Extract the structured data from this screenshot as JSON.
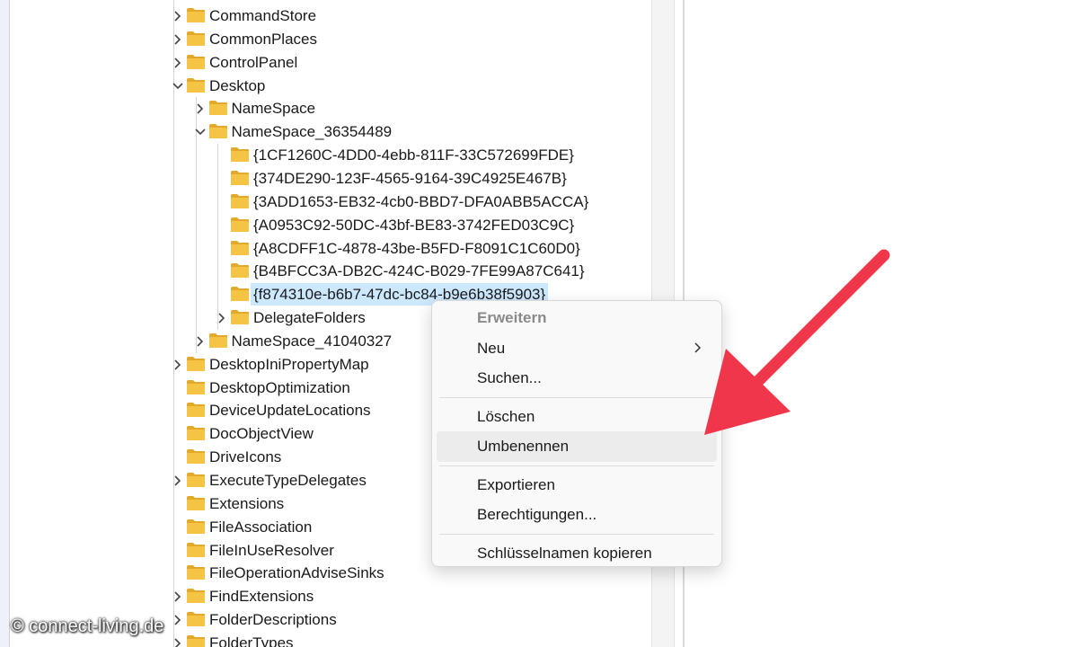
{
  "tree": {
    "nodes": [
      {
        "label": "CommandStore",
        "level": 0,
        "expander": "collapsed"
      },
      {
        "label": "CommonPlaces",
        "level": 0,
        "expander": "collapsed"
      },
      {
        "label": "ControlPanel",
        "level": 0,
        "expander": "collapsed"
      },
      {
        "label": "Desktop",
        "level": 0,
        "expander": "expanded"
      },
      {
        "label": "NameSpace",
        "level": 1,
        "expander": "collapsed"
      },
      {
        "label": "NameSpace_36354489",
        "level": 1,
        "expander": "expanded"
      },
      {
        "label": "{1CF1260C-4DD0-4ebb-811F-33C572699FDE}",
        "level": 2,
        "expander": "none"
      },
      {
        "label": "{374DE290-123F-4565-9164-39C4925E467B}",
        "level": 2,
        "expander": "none"
      },
      {
        "label": "{3ADD1653-EB32-4cb0-BBD7-DFA0ABB5ACCA}",
        "level": 2,
        "expander": "none"
      },
      {
        "label": "{A0953C92-50DC-43bf-BE83-3742FED03C9C}",
        "level": 2,
        "expander": "none"
      },
      {
        "label": "{A8CDFF1C-4878-43be-B5FD-F8091C1C60D0}",
        "level": 2,
        "expander": "none"
      },
      {
        "label": "{B4BFCC3A-DB2C-424C-B029-7FE99A87C641}",
        "level": 2,
        "expander": "none"
      },
      {
        "label": "{f874310e-b6b7-47dc-bc84-b9e6b38f5903}",
        "level": 2,
        "expander": "none",
        "selected": true
      },
      {
        "label": "DelegateFolders",
        "level": 2,
        "expander": "collapsed"
      },
      {
        "label": "NameSpace_41040327",
        "level": 1,
        "expander": "collapsed"
      },
      {
        "label": "DesktopIniPropertyMap",
        "level": 0,
        "expander": "collapsed"
      },
      {
        "label": "DesktopOptimization",
        "level": 0,
        "expander": "none"
      },
      {
        "label": "DeviceUpdateLocations",
        "level": 0,
        "expander": "none"
      },
      {
        "label": "DocObjectView",
        "level": 0,
        "expander": "none"
      },
      {
        "label": "DriveIcons",
        "level": 0,
        "expander": "none"
      },
      {
        "label": "ExecuteTypeDelegates",
        "level": 0,
        "expander": "collapsed"
      },
      {
        "label": "Extensions",
        "level": 0,
        "expander": "none"
      },
      {
        "label": "FileAssociation",
        "level": 0,
        "expander": "none"
      },
      {
        "label": "FileInUseResolver",
        "level": 0,
        "expander": "none"
      },
      {
        "label": "FileOperationAdviseSinks",
        "level": 0,
        "expander": "none"
      },
      {
        "label": "FindExtensions",
        "level": 0,
        "expander": "collapsed"
      },
      {
        "label": "FolderDescriptions",
        "level": 0,
        "expander": "collapsed"
      },
      {
        "label": "FolderTypes",
        "level": 0,
        "expander": "collapsed"
      }
    ]
  },
  "context_menu": {
    "items": [
      {
        "label": "Erweitern",
        "disabled": true
      },
      {
        "label": "Neu",
        "submenu": true
      },
      {
        "label": "Suchen..."
      },
      {
        "separator": true
      },
      {
        "label": "Löschen"
      },
      {
        "label": "Umbenennen",
        "hover": true
      },
      {
        "separator": true
      },
      {
        "label": "Exportieren"
      },
      {
        "label": "Berechtigungen..."
      },
      {
        "separator": true
      },
      {
        "label": "Schlüsselnamen kopieren"
      }
    ]
  },
  "annotation": {
    "arrow_color": "#f0364a"
  },
  "colors": {
    "folder": "#f6c445",
    "folder_dark": "#e2a92a",
    "selection": "#cce8ff"
  },
  "watermark": "© connect-living.de"
}
